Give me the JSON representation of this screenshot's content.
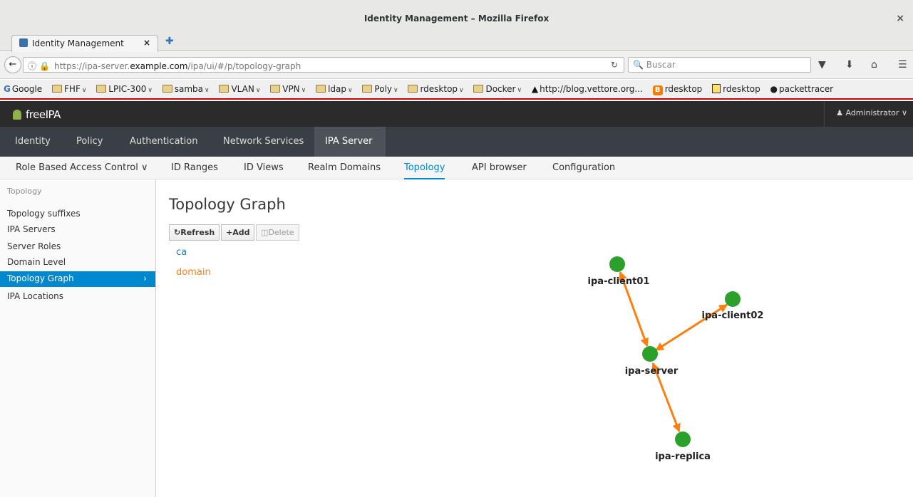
{
  "window": {
    "title": "Identity Management – Mozilla Firefox",
    "close": "×"
  },
  "browser": {
    "tab_title": "Identity Management",
    "tab_close": "×",
    "new_tab": "✚",
    "url_prefix": "https://ipa-server.",
    "url_domain": "example.com",
    "url_suffix": "/ipa/ui/#/p/topology-graph",
    "search_placeholder": "Buscar",
    "bookmarks": {
      "google": "Google",
      "fhf": "FHF",
      "lpic": "LPIC-300",
      "samba": "samba",
      "vlan": "VLAN",
      "vpn": "VPN",
      "ldap": "ldap",
      "poly": "Poly",
      "rdesktop_folder": "rdesktop",
      "docker": "Docker",
      "blog": "http://blog.vettore.org...",
      "rdesktop1": "rdesktop",
      "rdesktop2": "rdesktop",
      "packettracer": "packettracer"
    }
  },
  "header": {
    "logo": "freeIPA",
    "user": "Administrator"
  },
  "primary_nav": {
    "identity": "Identity",
    "policy": "Policy",
    "authentication": "Authentication",
    "network_services": "Network Services",
    "ipa_server": "IPA Server"
  },
  "secondary_nav": {
    "rbac": "Role Based Access Control",
    "id_ranges": "ID Ranges",
    "id_views": "ID Views",
    "realm_domains": "Realm Domains",
    "topology": "Topology",
    "api_browser": "API browser",
    "configuration": "Configuration"
  },
  "sidebar": {
    "title": "Topology",
    "items": {
      "suffixes": "Topology suffixes",
      "servers": "IPA Servers",
      "roles": "Server Roles",
      "domain_level": "Domain Level",
      "graph": "Topology Graph",
      "locations": "IPA Locations"
    }
  },
  "main": {
    "title": "Topology Graph",
    "refresh": "Refresh",
    "add": "Add",
    "delete": "Delete",
    "suffix_ca": "ca",
    "suffix_domain": "domain"
  },
  "graph": {
    "node_color": "#2ca02c",
    "edge_color": "#ff7f0e",
    "ca_color": "#1f77b4",
    "nodes": {
      "client01": "ipa-client01",
      "client02": "ipa-client02",
      "server": "ipa-server",
      "replica": "ipa-replica"
    }
  }
}
